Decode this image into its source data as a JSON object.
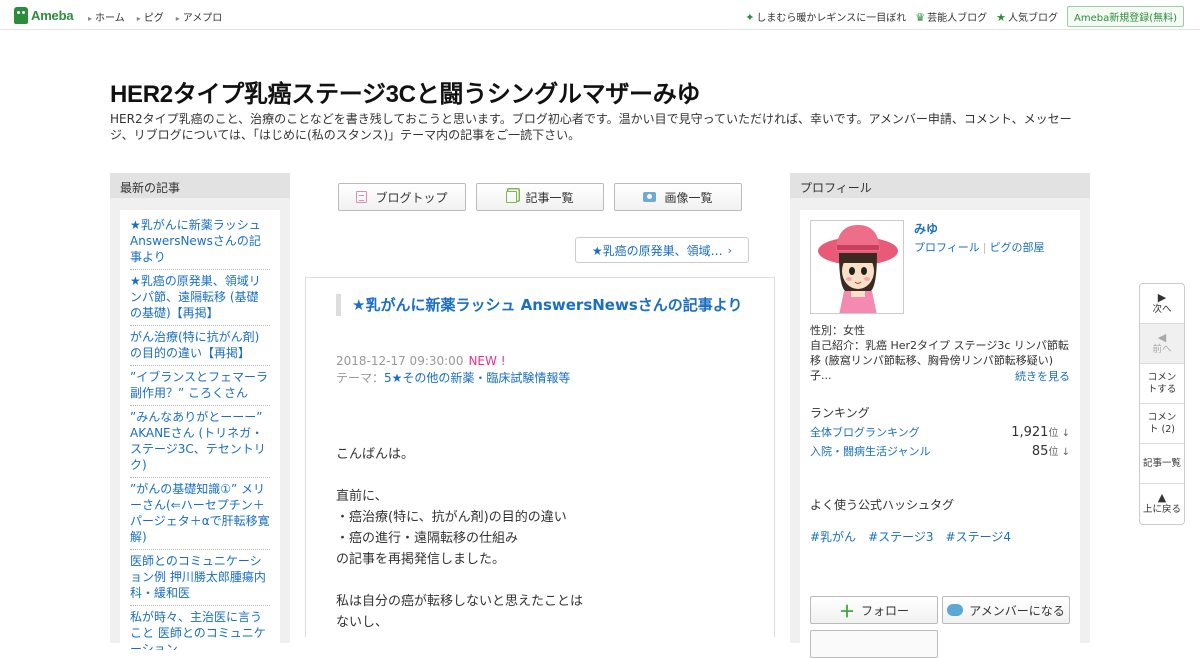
{
  "global_header": {
    "logo": "Ameba",
    "nav": [
      "ホーム",
      "ピグ",
      "アメプロ"
    ],
    "right_links": [
      "しまむら暖かレギンスに一目ぼれ",
      "芸能人ブログ",
      "人気ブログ"
    ],
    "register": "Ameba新規登録(無料)"
  },
  "blog": {
    "title": "HER2タイプ乳癌ステージ3Cと闘うシングルマザーみゆ",
    "description": "HER2タイプ乳癌のこと、治療のことなどを書き残しておこうと思います。ブログ初心者です。温かい目で見守っていただければ、幸いです。アメンバー申請、コメント、メッセージ、リブログについては、「はじめに(私のスタンス)」テーマ内の記事をご一読下さい。"
  },
  "left": {
    "heading": "最新の記事",
    "items": [
      "★乳がんに新薬ラッシュ AnswersNewsさんの記事より",
      "★乳癌の原発巣、領域リンパ節、遠隔転移 (基礎の基礎)【再掲】",
      "がん治療(特に抗がん剤)の目的の違い【再掲】",
      "”イブランスとフェマーラ副作用？” ころくさん",
      "”みんなありがとーーー” AKANEさん (トリネガ・ステージ3C、テセントリク)",
      "”がんの基礎知識①” メリーさん(⇐ハーセプチン＋パージェタ＋αで肝転移寛解)",
      "医師とのコミュニケーション例 押川勝太郎腫瘍内科・緩和医",
      "私が時々、主治医に言うこと 医師とのコミュニケーション"
    ]
  },
  "center": {
    "tabs": [
      "ブログトップ",
      "記事一覧",
      "画像一覧"
    ],
    "next_post": "★乳癌の原発巣、領域…",
    "article": {
      "title": "★乳がんに新薬ラッシュ AnswersNewsさんの記事より",
      "date": "2018-12-17 09:30:00",
      "new_badge": "NEW !",
      "theme_label": "テーマ：",
      "theme": "5★その他の新薬・臨床試験情報等",
      "body": [
        "こんばんは。",
        "",
        "直前に、",
        "・癌治療(特に、抗がん剤)の目的の違い",
        "・癌の進行・遠隔転移の仕組み",
        "の記事を再掲発信しました。",
        "",
        "私は自分の癌が転移しないと思えたことは",
        "ないし、"
      ]
    }
  },
  "right": {
    "heading": "プロフィール",
    "name": "みゆ",
    "links": [
      "プロフィール",
      "ピグの部屋"
    ],
    "gender": "性別：女性",
    "intro": "自己紹介：乳癌 Her2タイプ ステージ3c リンパ節転移 (腋窩リンパ節転移、胸骨傍リンパ節転移疑い) 子...",
    "more": "続きを見る",
    "ranking_heading": "ランキング",
    "rankings": [
      {
        "label": "全体ブログランキング",
        "value": "1,921",
        "unit": "位 ↓"
      },
      {
        "label": "入院・闘病生活ジャンル",
        "value": "85",
        "unit": "位 ↓"
      }
    ],
    "hashtag_heading": "よく使う公式ハッシュタグ",
    "hashtags": [
      "#乳がん",
      "#ステージ3",
      "#ステージ4"
    ],
    "follow": "フォロー",
    "amember": "アメンバーになる"
  },
  "side_nav": [
    {
      "arrow": "▶",
      "label": "次へ"
    },
    {
      "arrow": "◀",
      "label": "前へ"
    },
    {
      "arrow": "",
      "label": "コメントする"
    },
    {
      "arrow": "",
      "label": "コメント (2)"
    },
    {
      "arrow": "",
      "label": "記事一覧"
    },
    {
      "arrow": "▲",
      "label": "上に戻る"
    }
  ]
}
